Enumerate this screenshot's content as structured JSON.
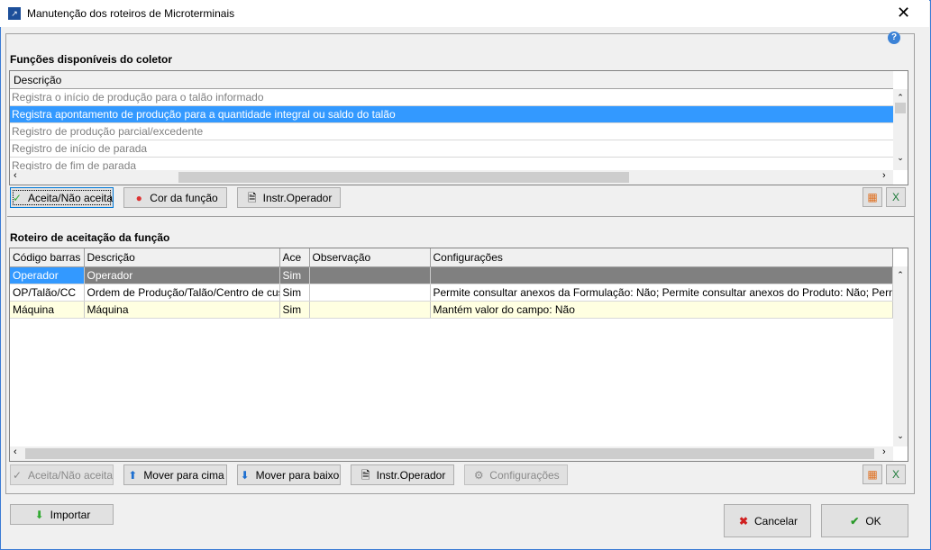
{
  "window": {
    "title": "Manutenção dos roteiros de Microterminais",
    "close": "✕",
    "help": "?"
  },
  "functions": {
    "section_title": "Funções disponíveis do coletor",
    "column": "Descrição",
    "rows": [
      "Registra o início de produção para o talão informado",
      "Registra apontamento de produção para a quantidade integral ou saldo do talão",
      "Registro de produção parcial/excedente",
      "Registro de início de parada",
      "Registro de fim de parada"
    ],
    "selected_index": 1,
    "buttons": {
      "accept": "Aceita/Não aceita",
      "color": "Cor da função",
      "instr": "Instr.Operador"
    }
  },
  "routing": {
    "section_title": "Roteiro de aceitação da função",
    "columns": [
      "Código barras",
      "Descrição",
      "Ace",
      "Observação",
      "Configurações"
    ],
    "rows": [
      [
        "Operador",
        "Operador",
        "Sim",
        "",
        ""
      ],
      [
        "OP/Talão/CC",
        "Ordem de Produção/Talão/Centro de custo",
        "Sim",
        "",
        "Permite consultar anexos da Formulação: Não; Permite consultar anexos do Produto: Não; Permite consu"
      ],
      [
        "Máquina",
        "Máquina",
        "Sim",
        "",
        "Mantém valor do campo: Não"
      ]
    ],
    "buttons": {
      "accept": "Aceita/Não aceita",
      "up": "Mover para cima",
      "down": "Mover para baixo",
      "instr": "Instr.Operador",
      "config": "Configurações"
    }
  },
  "footer": {
    "import": "Importar",
    "cancel": "Cancelar",
    "ok": "OK"
  },
  "colors": {
    "selection": "#3399ff",
    "highlight_row": "#ffffe1",
    "active_row": "#808080"
  }
}
